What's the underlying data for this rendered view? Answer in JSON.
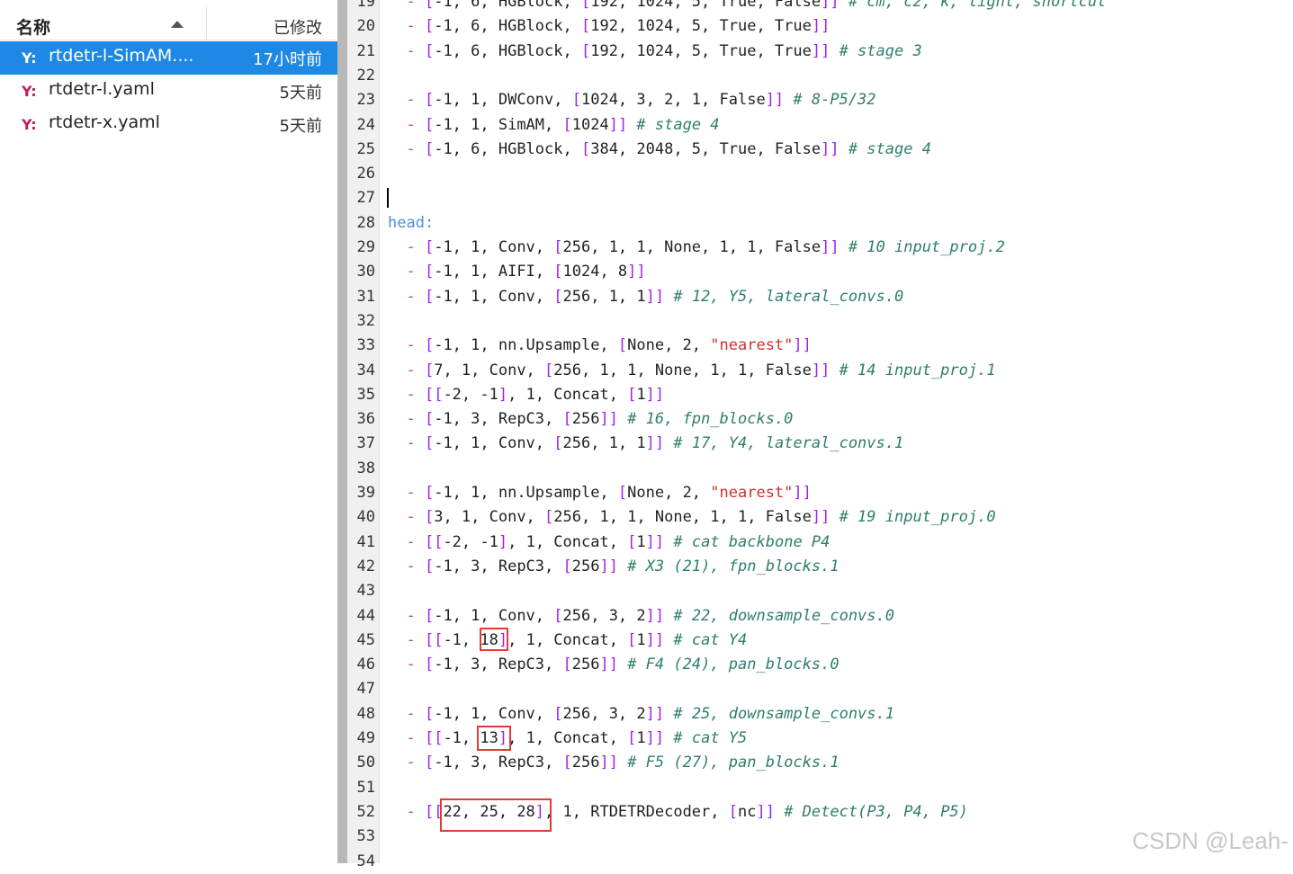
{
  "sidebar": {
    "col_name": "名称",
    "col_modified": "已修改",
    "files": [
      {
        "icon": "Y:",
        "name": "rtdetr-l-SimAM....",
        "time": "17小时前",
        "selected": true
      },
      {
        "icon": "Y:",
        "name": "rtdetr-l.yaml",
        "time": "5天前",
        "selected": false
      },
      {
        "icon": "Y:",
        "name": "rtdetr-x.yaml",
        "time": "5天前",
        "selected": false
      }
    ]
  },
  "editor": {
    "line_start": 19,
    "lines": [
      [
        [
          "  - ",
          "d"
        ],
        [
          "[",
          "b"
        ],
        [
          "-1, 6, HGBlock, ",
          "t"
        ],
        [
          "[",
          "b"
        ],
        [
          "192, 1024, 5, True, False",
          "t"
        ],
        [
          "]]",
          "b"
        ],
        [
          " # cm, c2, k, light, shortcut",
          "c"
        ]
      ],
      [
        [
          "  - ",
          "d"
        ],
        [
          "[",
          "b"
        ],
        [
          "-1, 6, HGBlock, ",
          "t"
        ],
        [
          "[",
          "b"
        ],
        [
          "192, 1024, 5, True, True",
          "t"
        ],
        [
          "]]",
          "b"
        ]
      ],
      [
        [
          "  - ",
          "d"
        ],
        [
          "[",
          "b"
        ],
        [
          "-1, 6, HGBlock, ",
          "t"
        ],
        [
          "[",
          "b"
        ],
        [
          "192, 1024, 5, True, True",
          "t"
        ],
        [
          "]]",
          "b"
        ],
        [
          " # stage 3",
          "c"
        ]
      ],
      [],
      [
        [
          "  - ",
          "d"
        ],
        [
          "[",
          "b"
        ],
        [
          "-1, 1, DWConv, ",
          "t"
        ],
        [
          "[",
          "b"
        ],
        [
          "1024, 3, 2, 1, False",
          "t"
        ],
        [
          "]]",
          "b"
        ],
        [
          " # 8-P5/32",
          "c"
        ]
      ],
      [
        [
          "  - ",
          "d"
        ],
        [
          "[",
          "b"
        ],
        [
          "-1, 1, SimAM, ",
          "t"
        ],
        [
          "[",
          "b"
        ],
        [
          "1024",
          "t"
        ],
        [
          "]]",
          "b"
        ],
        [
          " # stage 4",
          "c"
        ]
      ],
      [
        [
          "  - ",
          "d"
        ],
        [
          "[",
          "b"
        ],
        [
          "-1, 6, HGBlock, ",
          "t"
        ],
        [
          "[",
          "b"
        ],
        [
          "384, 2048, 5, True, False",
          "t"
        ],
        [
          "]]",
          "b"
        ],
        [
          " # stage 4",
          "c"
        ]
      ],
      [],
      [],
      [
        [
          "head:",
          "k"
        ]
      ],
      [
        [
          "  - ",
          "d"
        ],
        [
          "[",
          "b"
        ],
        [
          "-1, 1, Conv, ",
          "t"
        ],
        [
          "[",
          "b"
        ],
        [
          "256, 1, 1, None, 1, 1, False",
          "t"
        ],
        [
          "]]",
          "b"
        ],
        [
          " # 10 input_proj.2",
          "c"
        ]
      ],
      [
        [
          "  - ",
          "d"
        ],
        [
          "[",
          "b"
        ],
        [
          "-1, 1, AIFI, ",
          "t"
        ],
        [
          "[",
          "b"
        ],
        [
          "1024, 8",
          "t"
        ],
        [
          "]]",
          "b"
        ]
      ],
      [
        [
          "  - ",
          "d"
        ],
        [
          "[",
          "b"
        ],
        [
          "-1, 1, Conv, ",
          "t"
        ],
        [
          "[",
          "b"
        ],
        [
          "256, 1, 1",
          "t"
        ],
        [
          "]]",
          "b"
        ],
        [
          " # 12, Y5, lateral_convs.0",
          "c"
        ]
      ],
      [],
      [
        [
          "  - ",
          "d"
        ],
        [
          "[",
          "b"
        ],
        [
          "-1, 1, nn.Upsample, ",
          "t"
        ],
        [
          "[",
          "b"
        ],
        [
          "None, 2, ",
          "t"
        ],
        [
          "\"nearest\"",
          "s"
        ],
        [
          "]]",
          "b"
        ]
      ],
      [
        [
          "  - ",
          "d"
        ],
        [
          "[",
          "b"
        ],
        [
          "7, 1, Conv, ",
          "t"
        ],
        [
          "[",
          "b"
        ],
        [
          "256, 1, 1, None, 1, 1, False",
          "t"
        ],
        [
          "]]",
          "b"
        ],
        [
          " # 14 input_proj.1",
          "c"
        ]
      ],
      [
        [
          "  - ",
          "d"
        ],
        [
          "[[",
          "b"
        ],
        [
          "-2, -1",
          "t"
        ],
        [
          "]",
          "b"
        ],
        [
          ", 1, Concat, ",
          "t"
        ],
        [
          "[",
          "b"
        ],
        [
          "1",
          "t"
        ],
        [
          "]]",
          "b"
        ]
      ],
      [
        [
          "  - ",
          "d"
        ],
        [
          "[",
          "b"
        ],
        [
          "-1, 3, RepC3, ",
          "t"
        ],
        [
          "[",
          "b"
        ],
        [
          "256",
          "t"
        ],
        [
          "]]",
          "b"
        ],
        [
          " # 16, fpn_blocks.0",
          "c"
        ]
      ],
      [
        [
          "  - ",
          "d"
        ],
        [
          "[",
          "b"
        ],
        [
          "-1, 1, Conv, ",
          "t"
        ],
        [
          "[",
          "b"
        ],
        [
          "256, 1, 1",
          "t"
        ],
        [
          "]]",
          "b"
        ],
        [
          " # 17, Y4, lateral_convs.1",
          "c"
        ]
      ],
      [],
      [
        [
          "  - ",
          "d"
        ],
        [
          "[",
          "b"
        ],
        [
          "-1, 1, nn.Upsample, ",
          "t"
        ],
        [
          "[",
          "b"
        ],
        [
          "None, 2, ",
          "t"
        ],
        [
          "\"nearest\"",
          "s"
        ],
        [
          "]]",
          "b"
        ]
      ],
      [
        [
          "  - ",
          "d"
        ],
        [
          "[",
          "b"
        ],
        [
          "3, 1, Conv, ",
          "t"
        ],
        [
          "[",
          "b"
        ],
        [
          "256, 1, 1, None, 1, 1, False",
          "t"
        ],
        [
          "]]",
          "b"
        ],
        [
          " # 19 input_proj.0",
          "c"
        ]
      ],
      [
        [
          "  - ",
          "d"
        ],
        [
          "[[",
          "b"
        ],
        [
          "-2, -1",
          "t"
        ],
        [
          "]",
          "b"
        ],
        [
          ", 1, Concat, ",
          "t"
        ],
        [
          "[",
          "b"
        ],
        [
          "1",
          "t"
        ],
        [
          "]]",
          "b"
        ],
        [
          " # cat backbone P4",
          "c"
        ]
      ],
      [
        [
          "  - ",
          "d"
        ],
        [
          "[",
          "b"
        ],
        [
          "-1, 3, RepC3, ",
          "t"
        ],
        [
          "[",
          "b"
        ],
        [
          "256",
          "t"
        ],
        [
          "]]",
          "b"
        ],
        [
          " # X3 (21), fpn_blocks.1",
          "c"
        ]
      ],
      [],
      [
        [
          "  - ",
          "d"
        ],
        [
          "[",
          "b"
        ],
        [
          "-1, 1, Conv, ",
          "t"
        ],
        [
          "[",
          "b"
        ],
        [
          "256, 3, 2",
          "t"
        ],
        [
          "]]",
          "b"
        ],
        [
          " # 22, downsample_convs.0",
          "c"
        ]
      ],
      [
        [
          "  - ",
          "d"
        ],
        [
          "[[",
          "b"
        ],
        [
          "-1, 18",
          "t"
        ],
        [
          "]",
          "b"
        ],
        [
          ", 1, Concat, ",
          "t"
        ],
        [
          "[",
          "b"
        ],
        [
          "1",
          "t"
        ],
        [
          "]]",
          "b"
        ],
        [
          " # cat Y4",
          "c"
        ]
      ],
      [
        [
          "  - ",
          "d"
        ],
        [
          "[",
          "b"
        ],
        [
          "-1, 3, RepC3, ",
          "t"
        ],
        [
          "[",
          "b"
        ],
        [
          "256",
          "t"
        ],
        [
          "]]",
          "b"
        ],
        [
          " # F4 (24), pan_blocks.0",
          "c"
        ]
      ],
      [],
      [
        [
          "  - ",
          "d"
        ],
        [
          "[",
          "b"
        ],
        [
          "-1, 1, Conv, ",
          "t"
        ],
        [
          "[",
          "b"
        ],
        [
          "256, 3, 2",
          "t"
        ],
        [
          "]]",
          "b"
        ],
        [
          " # 25, downsample_convs.1",
          "c"
        ]
      ],
      [
        [
          "  - ",
          "d"
        ],
        [
          "[[",
          "b"
        ],
        [
          "-1, 13",
          "t"
        ],
        [
          "]",
          "b"
        ],
        [
          ", 1, Concat, ",
          "t"
        ],
        [
          "[",
          "b"
        ],
        [
          "1",
          "t"
        ],
        [
          "]]",
          "b"
        ],
        [
          " # cat Y5",
          "c"
        ]
      ],
      [
        [
          "  - ",
          "d"
        ],
        [
          "[",
          "b"
        ],
        [
          "-1, 3, RepC3, ",
          "t"
        ],
        [
          "[",
          "b"
        ],
        [
          "256",
          "t"
        ],
        [
          "]]",
          "b"
        ],
        [
          " # F5 (27), pan_blocks.1",
          "c"
        ]
      ],
      [],
      [
        [
          "  - ",
          "d"
        ],
        [
          "[[",
          "b"
        ],
        [
          "22, 25, 28",
          "t"
        ],
        [
          "]",
          "b"
        ],
        [
          ", 1, RTDETRDecoder, ",
          "t"
        ],
        [
          "[",
          "b"
        ],
        [
          "nc",
          "t"
        ],
        [
          "]]",
          "b"
        ],
        [
          " # Detect(P3, P4, P5)",
          "c"
        ]
      ],
      [],
      []
    ]
  },
  "colors": {
    "b": "#a020f0",
    "t": "#222222",
    "c": "#2e7d6e",
    "s": "#d32f2f",
    "k": "#4f8fd8",
    "d": "#c040c0"
  },
  "watermark": "CSDN @Leah-"
}
